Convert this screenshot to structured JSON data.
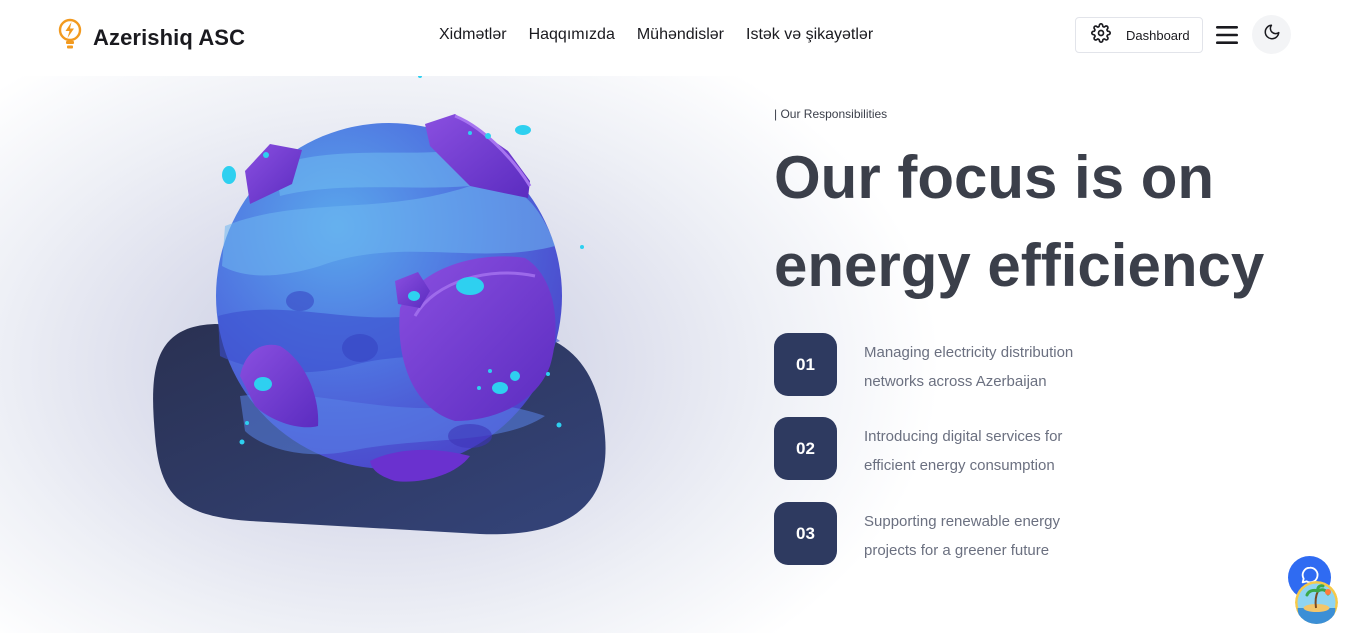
{
  "header": {
    "brand_name": "Azerishiq ASC",
    "brand_icon": "lightbulb-bolt-icon",
    "nav": [
      {
        "label": "Xidmətlər"
      },
      {
        "label": "Haqqımızda"
      },
      {
        "label": "Mühəndislər"
      },
      {
        "label": "Istək və şikayətlər"
      }
    ],
    "dashboard_label": "Dashboard",
    "dashboard_icon": "gear-icon",
    "menu_icon": "hamburger-menu-icon",
    "theme_icon": "moon-icon"
  },
  "hero": {
    "tagline": "| Our Responsibilities",
    "title": "Our focus is on energy efficiency",
    "items": [
      {
        "number": "01",
        "text": "Managing electricity distribution networks across Azerbaijan"
      },
      {
        "number": "02",
        "text": "Introducing digital services for efficient energy consumption"
      },
      {
        "number": "03",
        "text": "Supporting renewable energy projects for a greener future"
      }
    ]
  },
  "colors": {
    "accent": "#2e3a60",
    "title_text": "#3b3f4a",
    "body_text": "#6b7080",
    "brand_orange": "#f29a1f",
    "chat_blue": "#2f6bf2"
  },
  "widgets": {
    "chat_icon": "chat-bubble-icon",
    "avatar_icon": "island-avatar-icon"
  }
}
